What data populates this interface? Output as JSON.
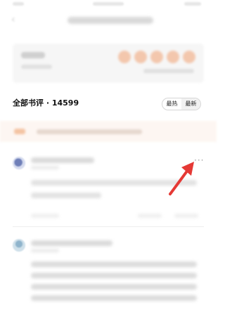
{
  "reviews_section": {
    "title": "全部书评 · 14599",
    "sort": {
      "hot_label": "最热",
      "new_label": "最新"
    }
  },
  "review_1": {
    "more_label": "···"
  },
  "icons": {
    "back": "back-arrow-icon",
    "more": "more-dots-icon",
    "pointer": "red-arrow-annotation"
  },
  "colors": {
    "accent": "#e53935",
    "star": "#f3c7ad",
    "notice_bg": "#fdf6f2"
  }
}
